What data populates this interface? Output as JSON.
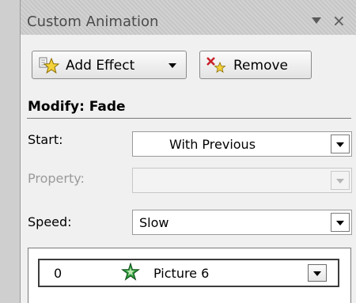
{
  "pane": {
    "title": "Custom Animation",
    "title_dropdown_icon": "triangle-down-icon",
    "close_glyph": "×"
  },
  "toolbar": {
    "add_effect_label": "Add Effect",
    "add_effect_icon": "add-effect-star-icon",
    "remove_label": "Remove",
    "remove_icon": "remove-effect-icon"
  },
  "modify": {
    "heading": "Modify: Fade",
    "start_label": "Start:",
    "start_value": "With Previous",
    "property_label": "Property:",
    "property_value": "",
    "speed_label": "Speed:",
    "speed_value": "Slow"
  },
  "effects_list": {
    "items": [
      {
        "order": "0",
        "icon": "entrance-effect-star-icon",
        "name": "Picture 6"
      }
    ]
  },
  "colors": {
    "star_yellow": "#f3d23a",
    "star_green": "#2e9e3b",
    "remove_red": "#c8202a",
    "disabled_text": "#9a9a9a"
  }
}
